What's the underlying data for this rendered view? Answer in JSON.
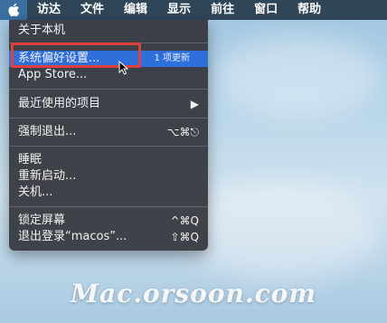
{
  "menubar": {
    "items": [
      "访达",
      "文件",
      "编辑",
      "显示",
      "前往",
      "窗口",
      "帮助"
    ]
  },
  "apple_menu": {
    "about": "关于本机",
    "system_prefs": "系统偏好设置...",
    "system_prefs_badge": "1 项更新",
    "app_store": "App Store...",
    "recent_items": "最近使用的项目",
    "recent_items_arrow": "▶",
    "force_quit": "强制退出...",
    "force_quit_shortcut": "⌥⌘⎋",
    "sleep": "睡眠",
    "restart": "重新启动...",
    "shutdown": "关机...",
    "lock_screen": "锁定屏幕",
    "lock_screen_shortcut": "^⌘Q",
    "logout": "退出登录“macos”...",
    "logout_shortcut": "⇧⌘Q"
  },
  "watermark": "Mac.orsoon.com",
  "colors": {
    "menubar_bg": "#2f4659",
    "menu_bg": "#34363c",
    "highlight": "#2f6fdc",
    "annotation_box": "#e0403c"
  },
  "icons": [
    "apple-logo-icon",
    "chevron-right-icon",
    "mouse-pointer-icon"
  ]
}
